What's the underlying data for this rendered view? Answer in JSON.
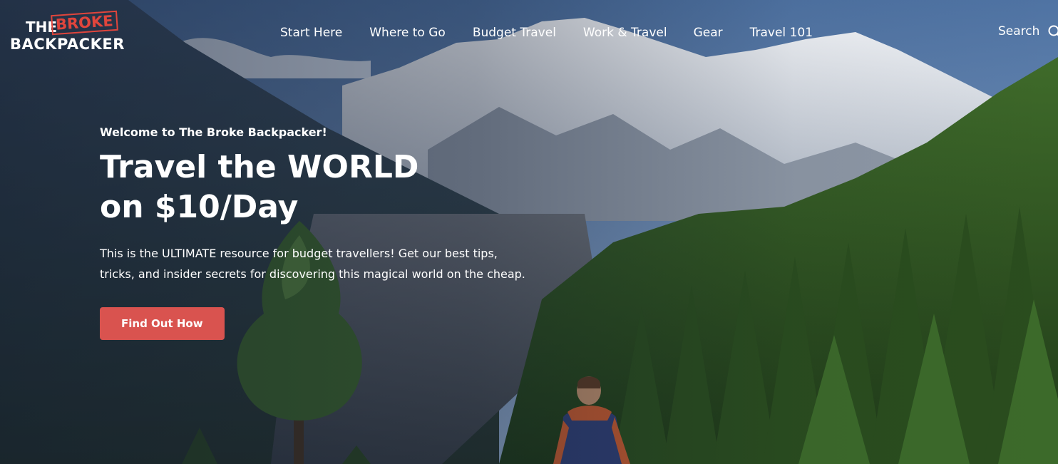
{
  "header": {
    "logo": {
      "line1": "THE",
      "line2": "BROKE",
      "line3": "BACKPACKER"
    },
    "nav": [
      {
        "label": "Start Here"
      },
      {
        "label": "Where to Go"
      },
      {
        "label": "Budget Travel"
      },
      {
        "label": "Work & Travel"
      },
      {
        "label": "Gear"
      },
      {
        "label": "Travel 101"
      }
    ],
    "search_label": "Search",
    "search_icon": "search-icon"
  },
  "hero": {
    "eyebrow": "Welcome to The Broke Backpacker!",
    "headline": "Travel the WORLD on $10/Day",
    "blurb": "This is the ULTIMATE resource for budget travellers! Get our best tips, tricks, and insider secrets for discovering this magical world on the cheap.",
    "cta_label": "Find Out How"
  },
  "colors": {
    "accent": "#d9534f",
    "logo_red": "#e0453c",
    "text": "#ffffff"
  }
}
